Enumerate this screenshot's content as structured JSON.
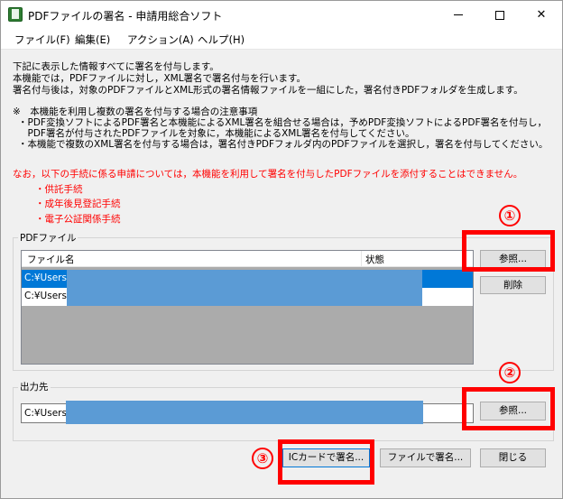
{
  "window": {
    "title": "PDFファイルの署名 - 申請用総合ソフト",
    "controls": {
      "minimize": "minimize",
      "maximize": "maximize",
      "close": "✕"
    }
  },
  "menu": [
    "ファイル(F)",
    "編集(E)",
    "アクション(A)",
    "ヘルプ(H)"
  ],
  "info": {
    "lines": [
      "下記に表示した情報すべてに署名を付与します。",
      "本機能では，PDFファイルに対し，XML署名で署名付与を行います。",
      "署名付与後は，対象のPDFファイルとXML形式の署名情報ファイルを一組にした，署名付きPDFフォルダを生成します。"
    ],
    "note_title": "※　本機能を利用し複数の署名を付与する場合の注意事項",
    "note_lines": [
      "・PDF変換ソフトによるPDF署名と本機能によるXML署名を組合せる場合は，予めPDF変換ソフトによるPDF署名を付与し，",
      "　PDF署名が付与されたPDFファイルを対象に，本機能によるXML署名を付与してください。",
      "・本機能で複数のXML署名を付与する場合は，署名付きPDFフォルダ内のPDFファイルを選択し，署名を付与してください。"
    ]
  },
  "warning": {
    "text": "なお，以下の手続に係る申請については，本機能を利用して署名を付与したPDFファイルを添付することはできません。",
    "items": [
      "・供託手続",
      "・成年後見登記手続",
      "・電子公証関係手続"
    ]
  },
  "pdf_group": {
    "label": "PDFファイル",
    "columns": [
      "ファイル名",
      "状態"
    ],
    "rows": [
      {
        "file": "C:¥Users",
        "status": ""
      },
      {
        "file": "C:¥Users",
        "status": ""
      }
    ],
    "browse_label": "参照...",
    "delete_label": "削除"
  },
  "output_group": {
    "label": "出力先",
    "path": "C:¥Users",
    "browse_label": "参照..."
  },
  "buttons": {
    "ic_sign": "ICカードで署名...",
    "file_sign": "ファイルで署名...",
    "close": "閉じる"
  },
  "annotations": [
    "①",
    "②",
    "③"
  ],
  "colors": {
    "highlight": "#ff0000",
    "selection": "#0078d7",
    "redaction": "#5b9bd5"
  }
}
